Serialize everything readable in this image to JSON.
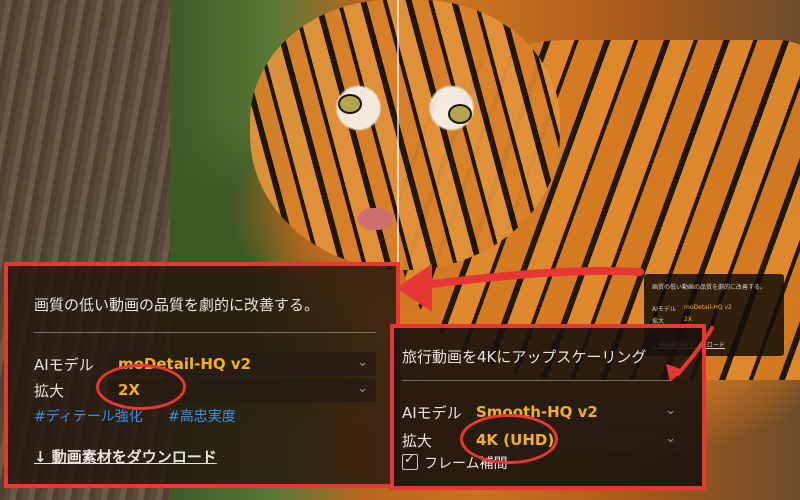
{
  "panel_main": {
    "title": "画質の低い動画の品質を劇的に改善する。",
    "ai_model_label": "AIモデル",
    "ai_model_value": "moDetail-HQ v2",
    "scale_label": "拡大",
    "scale_value": "2X",
    "tags": [
      "#ディテール強化",
      "#高忠実度"
    ],
    "download_link": "↓ 動画素材をダウンロード"
  },
  "panel_mini": {
    "title": "画質の低い動画の品質を劇的に改善する。",
    "ai_model_label": "AIモデル",
    "ai_model_value": "moDetail-HQ v2",
    "scale_label": "拡大",
    "scale_value": "2X",
    "download_link": "↓ 動画素材をダウンロード"
  },
  "panel_second": {
    "title": "旅行動画を4Kにアップスケーリング",
    "ai_model_label": "AIモデル",
    "ai_model_value": "Smooth-HQ v2",
    "scale_label": "拡大",
    "scale_value": "4K (UHD)",
    "checkbox_label": "フレーム補間",
    "checkbox_checked": true
  },
  "colors": {
    "highlight_red": "#e53835",
    "value_orange": "#f2b21f",
    "tag_blue": "#3f8fe0"
  },
  "icons": {
    "chevron": "chevron-down-icon",
    "checkbox": "checkbox-checked-icon"
  }
}
